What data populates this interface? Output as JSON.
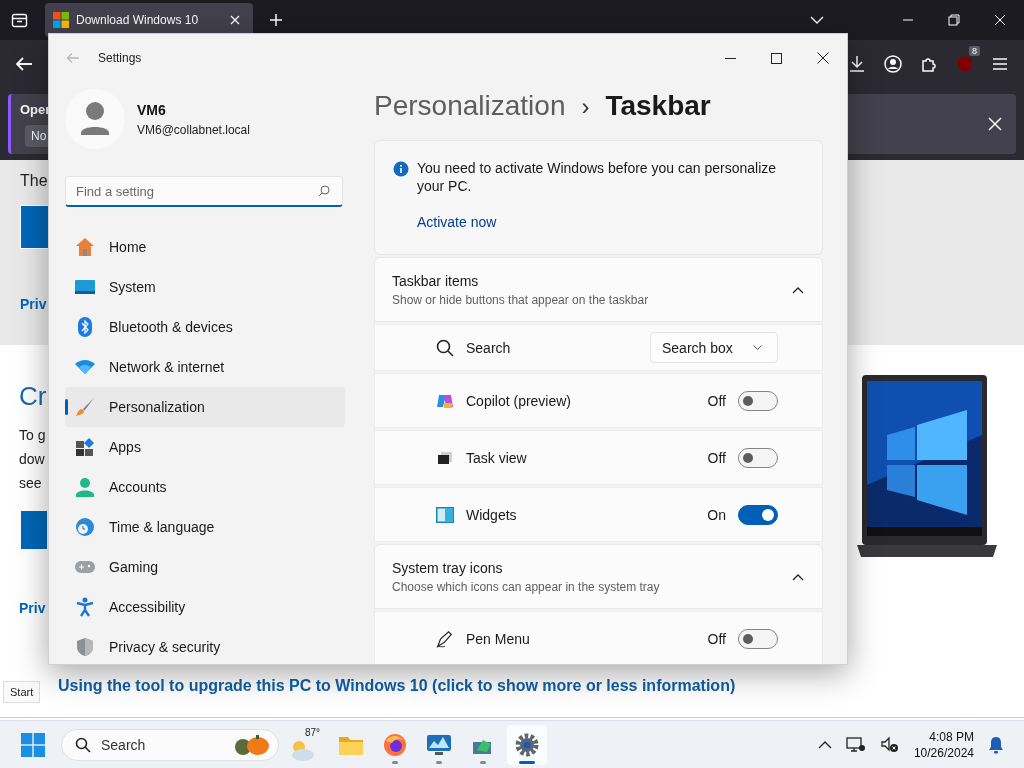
{
  "browser": {
    "tab_title": "Download Windows 10",
    "extension_badge": "8",
    "notice": {
      "title": "Oper",
      "button": "No"
    }
  },
  "web_page": {
    "intro": "The",
    "link_1": "Priv",
    "heading": "Cr",
    "paragraph_lines": [
      "To g",
      "dow",
      "see"
    ],
    "link_2": "Priv",
    "expander": "Using the tool to upgrade this PC to Windows 10 (click to show more or less information)"
  },
  "tooltip": "Start",
  "settings": {
    "title": "Settings",
    "user": {
      "name": "VM6",
      "email": "VM6@collabnet.local"
    },
    "search": {
      "placeholder": "Find a setting"
    },
    "nav": [
      {
        "label": "Home",
        "selected": false
      },
      {
        "label": "System",
        "selected": false
      },
      {
        "label": "Bluetooth & devices",
        "selected": false
      },
      {
        "label": "Network & internet",
        "selected": false
      },
      {
        "label": "Personalization",
        "selected": true
      },
      {
        "label": "Apps",
        "selected": false
      },
      {
        "label": "Accounts",
        "selected": false
      },
      {
        "label": "Time & language",
        "selected": false
      },
      {
        "label": "Gaming",
        "selected": false
      },
      {
        "label": "Accessibility",
        "selected": false
      },
      {
        "label": "Privacy & security",
        "selected": false
      }
    ],
    "breadcrumb": {
      "parent": "Personalization",
      "separator": "›",
      "current": "Taskbar"
    },
    "activation": {
      "message": "You need to activate Windows before you can personalize your PC.",
      "link": "Activate now"
    },
    "sections": [
      {
        "title": "Taskbar items",
        "subtitle": "Show or hide buttons that appear on the taskbar",
        "expanded": true,
        "rows": [
          {
            "kind": "dropdown",
            "label": "Search",
            "value": "Search box"
          },
          {
            "kind": "toggle",
            "label": "Copilot (preview)",
            "on": false,
            "state": "Off"
          },
          {
            "kind": "toggle",
            "label": "Task view",
            "on": false,
            "state": "Off"
          },
          {
            "kind": "toggle",
            "label": "Widgets",
            "on": true,
            "state": "On"
          }
        ]
      },
      {
        "title": "System tray icons",
        "subtitle": "Choose which icons can appear in the system tray",
        "expanded": true,
        "rows": [
          {
            "kind": "toggle",
            "label": "Pen Menu",
            "on": false,
            "state": "Off"
          }
        ]
      }
    ]
  },
  "taskbar": {
    "search_placeholder": "Search",
    "weather": "87°",
    "apps": [
      {
        "running": false,
        "selected": false
      },
      {
        "running": true,
        "selected": false
      },
      {
        "running": true,
        "selected": false
      },
      {
        "running": true,
        "selected": false
      },
      {
        "running": true,
        "selected": true
      }
    ],
    "time": "4:08 PM",
    "date": "10/26/2024"
  }
}
